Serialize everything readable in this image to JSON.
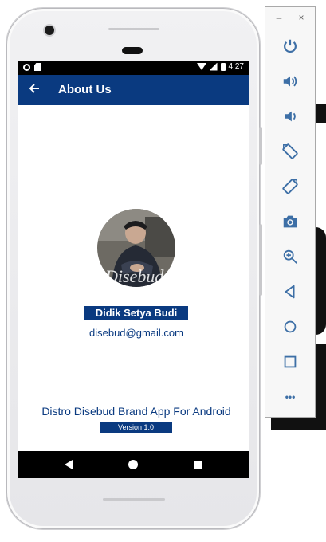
{
  "status_bar": {
    "time": "4:27"
  },
  "app_bar": {
    "back_icon": "arrow-left-icon",
    "title": "About Us"
  },
  "profile": {
    "name": "Didik Setya Budi",
    "email": "disebud@gmail.com",
    "photo_watermark": "Disebud"
  },
  "footer": {
    "tagline": "Distro Disebud Brand App For Android",
    "version": "Version 1.0"
  },
  "colors": {
    "primary": "#0a3a80",
    "accent_icon": "#3d6fa6"
  },
  "emulator_toolbar": {
    "window_controls": [
      "–",
      "×"
    ],
    "tools": [
      "power-icon",
      "volume-up-icon",
      "volume-down-icon",
      "rotate-left-icon",
      "rotate-right-icon",
      "camera-icon",
      "zoom-icon",
      "back-icon",
      "home-icon",
      "overview-icon",
      "more-icon"
    ],
    "more_label": "•••"
  }
}
